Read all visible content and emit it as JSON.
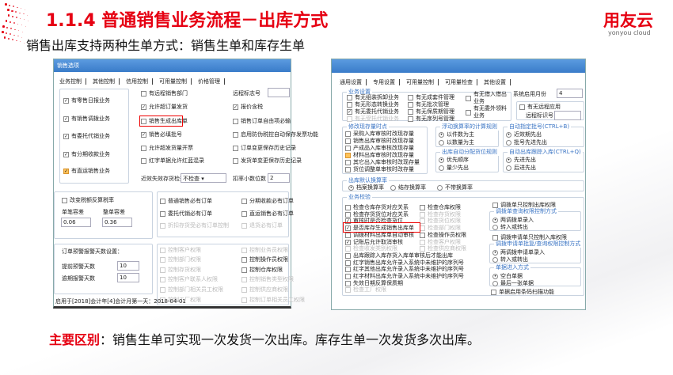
{
  "header": {
    "title": "1.1.4 普通销售业务流程－出库方式",
    "subtitle": "销售出库支持两种生单方式：销售生单和库存生单",
    "logo": "用友云",
    "logo_sub": "yonyou cloud"
  },
  "left_window": {
    "title": "销售选项",
    "tabs": [
      "业务控制",
      "其他控制",
      "信用控制",
      "可用量控制",
      "价格管理"
    ],
    "controls": [
      {
        "type": "cb",
        "label": "有零售日报业务",
        "checked": true
      },
      {
        "type": "cb",
        "label": "有销售调拨业务",
        "checked": true
      },
      {
        "type": "cb",
        "label": "有委托代销业务",
        "checked": true
      },
      {
        "type": "cb",
        "label": "有分期收款业务",
        "checked": true
      },
      {
        "type": "cb",
        "label": "有直运销售业务",
        "checked": true,
        "orange": true
      },
      {
        "type": "cb",
        "label": "有远程销售部门",
        "checked": false
      },
      {
        "type": "cb",
        "label": "允许超订量发货",
        "checked": true
      },
      {
        "type": "cb",
        "label": "销售生成出库单",
        "checked": false
      },
      {
        "type": "cb",
        "label": "销售必填批号",
        "checked": true
      },
      {
        "type": "cb",
        "label": "允许超发货量开票",
        "checked": false
      },
      {
        "type": "cb",
        "label": "红字单据允许红蓝混录",
        "checked": false
      },
      {
        "type": "input",
        "label": "远程标志号",
        "value": ""
      },
      {
        "type": "cb",
        "label": "报价含税",
        "checked": true
      },
      {
        "type": "cb",
        "label": "销售订单自由项必输",
        "checked": false
      },
      {
        "type": "cb",
        "label": "启用防伪税控自动保存发票功能",
        "checked": false
      },
      {
        "type": "cb",
        "label": "订单变更保存历史记录",
        "checked": false
      },
      {
        "type": "cb",
        "label": "发货单变更保存历史记录",
        "checked": false
      },
      {
        "type": "input",
        "label": "近效失效存货检查",
        "value": "不检查 ▾"
      },
      {
        "type": "input",
        "label": "扣率小数位数",
        "value": "2"
      },
      {
        "type": "cb",
        "label": "改变税额反算税率",
        "checked": false
      },
      {
        "type": "input",
        "label": "单笔容差",
        "value": "0.06"
      },
      {
        "type": "input",
        "label": "整单容差",
        "value": "0.36"
      },
      {
        "type": "cb",
        "label": "普通销售必有订单",
        "checked": false
      },
      {
        "type": "cb",
        "label": "分期收款必有订单",
        "checked": false
      },
      {
        "type": "cb",
        "label": "委托代销必有订单",
        "checked": false
      },
      {
        "type": "cb",
        "label": "直运销售必有订单",
        "checked": false
      },
      {
        "type": "cb",
        "label": "折扣存货受必有订单控制",
        "checked": false,
        "disabled": true
      },
      {
        "type": "cb",
        "label": "退货必有订单",
        "checked": false,
        "disabled": true
      },
      {
        "type": "text",
        "label": "订单预警报警天数设置："
      },
      {
        "type": "input",
        "label": "提前预警天数",
        "value": "10"
      },
      {
        "type": "input",
        "label": "逾期报警天数",
        "value": "10"
      },
      {
        "type": "cb",
        "label": "控制客户权限",
        "disabled": true
      },
      {
        "type": "cb",
        "label": "控制部门权限",
        "disabled": true
      },
      {
        "type": "cb",
        "label": "控制存货权限",
        "disabled": true
      },
      {
        "type": "cb",
        "label": "控制客户联系人权限",
        "disabled": true
      },
      {
        "type": "cb",
        "label": "控制部门相关员工权限",
        "disabled": true
      },
      {
        "type": "cb",
        "label": "控制工厂权限",
        "disabled": true
      },
      {
        "type": "cb",
        "label": "控制业务员权限",
        "disabled": true
      },
      {
        "type": "cb",
        "label": "控制操作员权限"
      },
      {
        "type": "cb",
        "label": "控制仓库权限"
      },
      {
        "type": "cb",
        "label": "控制销售类型权限",
        "disabled": true
      },
      {
        "type": "cb",
        "label": "控制供应商权限",
        "disabled": true
      },
      {
        "type": "cb",
        "label": "控制订单相关员工权限",
        "disabled": true
      },
      {
        "type": "text",
        "label": "启用于[2018]会计年[4]会计月第一天：2018-04-01"
      }
    ]
  },
  "right_window": {
    "tabs": [
      "通用设置",
      "专用设置",
      "可用量控制",
      "可用量检查",
      "其他设置"
    ],
    "groups": [
      "业务设置",
      "修改现存量时点",
      "浮动换算率的计算规则",
      "自动指定批号(CTRL+B)",
      "出库自动分配货位规则",
      "自动出库跟踪入库(CTRL+Q)",
      "出库默认换算率",
      "业务校验",
      "调拨单查询权限控制方式",
      "调拨申请单批复/查询权限控制方式",
      "单据进入方式"
    ],
    "controls": [
      {
        "type": "cb",
        "label": "有无组装拆卸业务"
      },
      {
        "type": "cb",
        "label": "有无形态转换业务"
      },
      {
        "type": "cb",
        "label": "有无委托代销业务",
        "checked": true
      },
      {
        "type": "cb",
        "label": "有无受托代销业务",
        "disabled": true
      },
      {
        "type": "cb",
        "label": "有无成套件管理"
      },
      {
        "type": "cb",
        "label": "有无批次管理"
      },
      {
        "type": "cb",
        "label": "有无保质期管理"
      },
      {
        "type": "cb",
        "label": "有无序列号管理"
      },
      {
        "type": "cb",
        "label": "有无借入借出业务"
      },
      {
        "type": "cb",
        "label": "有无委外领料业务"
      },
      {
        "type": "input",
        "label": "系统启用月份",
        "value": "4"
      },
      {
        "type": "cb",
        "label": "有无远程应用"
      },
      {
        "type": "input",
        "label": "远程标识号",
        "value": ""
      },
      {
        "type": "cb",
        "label": "采购入库审核时改现存量"
      },
      {
        "type": "cb",
        "label": "销售出库审核时改现存量"
      },
      {
        "type": "cb",
        "label": "产成品入库审核改现存量"
      },
      {
        "type": "cb",
        "label": "材料出库审核时改现存量",
        "orange": true
      },
      {
        "type": "cb",
        "label": "其它出入库审核时改现存量"
      },
      {
        "type": "cb",
        "label": "货位调整单审核时改存量"
      },
      {
        "type": "radio",
        "label": "以件数为主",
        "checked": true
      },
      {
        "type": "radio",
        "label": "以数量为主"
      },
      {
        "type": "radio",
        "label": "近效期先出",
        "checked": true
      },
      {
        "type": "radio",
        "label": "批号先进先出"
      },
      {
        "type": "radio",
        "label": "优先顺序",
        "checked": true
      },
      {
        "type": "radio",
        "label": "量少先出"
      },
      {
        "type": "radio",
        "label": "先进先出",
        "checked": true
      },
      {
        "type": "radio",
        "label": "后进先出"
      },
      {
        "type": "radio",
        "label": "档案换算率",
        "checked": true
      },
      {
        "type": "radio",
        "label": "结存换算率"
      },
      {
        "type": "radio",
        "label": "不带换算率"
      },
      {
        "type": "cb",
        "label": "检查仓库存货对应关系"
      },
      {
        "type": "cb",
        "label": "检查存货货位对应关系"
      },
      {
        "type": "cb",
        "label": "审核时是否检查货位",
        "checked": true
      },
      {
        "type": "cb",
        "label": "是否库存生成销售出库单",
        "checked": true
      },
      {
        "type": "cb",
        "label": "调拨材料出库单自动审核"
      },
      {
        "type": "cb",
        "label": "记账后允许取消审核",
        "checked": true
      },
      {
        "type": "cb",
        "label": "检查收发类别权限",
        "disabled": true
      },
      {
        "type": "cb",
        "label": "出库跟踪入库存货入库单审核后才能出库"
      },
      {
        "type": "cb",
        "label": "红字销售出库允许录入系统中未维护的序列号"
      },
      {
        "type": "cb",
        "label": "红字其他出库允许录入系统中未维护的序列号"
      },
      {
        "type": "cb",
        "label": "红字材料出库允许录入系统中未维护的序列号"
      },
      {
        "type": "cb",
        "label": "失效日期反算保质期"
      },
      {
        "type": "cb",
        "label": "检查工厂权限",
        "disabled": true
      },
      {
        "type": "cb",
        "label": "检查仓库权限"
      },
      {
        "type": "cb",
        "label": "检查存货权限",
        "disabled": true
      },
      {
        "type": "cb",
        "label": "检查货位权限",
        "disabled": true
      },
      {
        "type": "cb",
        "label": "检查部门权限",
        "disabled": true
      },
      {
        "type": "cb",
        "label": "检查操作员权限"
      },
      {
        "type": "cb",
        "label": "检查客户权限",
        "disabled": true
      },
      {
        "type": "cb",
        "label": "检查供应商权限",
        "disabled": true
      },
      {
        "type": "cb",
        "label": "调拨单只控制出库权限"
      },
      {
        "type": "radio",
        "label": "两调拨单录入",
        "checked": true
      },
      {
        "type": "radio",
        "label": "转入或转出"
      },
      {
        "type": "cb",
        "label": "调拨申请单只控制入库权限"
      },
      {
        "type": "radio",
        "label": "两调拨申请单录入",
        "checked": true
      },
      {
        "type": "radio",
        "label": "转入或转出"
      },
      {
        "type": "radio",
        "label": "空白单据",
        "checked": true
      },
      {
        "type": "radio",
        "label": "最后一张单据"
      },
      {
        "type": "cb",
        "label": "单据启用条码扫描功能"
      }
    ]
  },
  "footer": {
    "highlight": "主要区别",
    "text": "：销售生单可实现一次发货一次出库。库存生单一次发货多次出库。"
  },
  "colors": {
    "brand": "#e60012",
    "titlebar": "#3a7cc9"
  }
}
